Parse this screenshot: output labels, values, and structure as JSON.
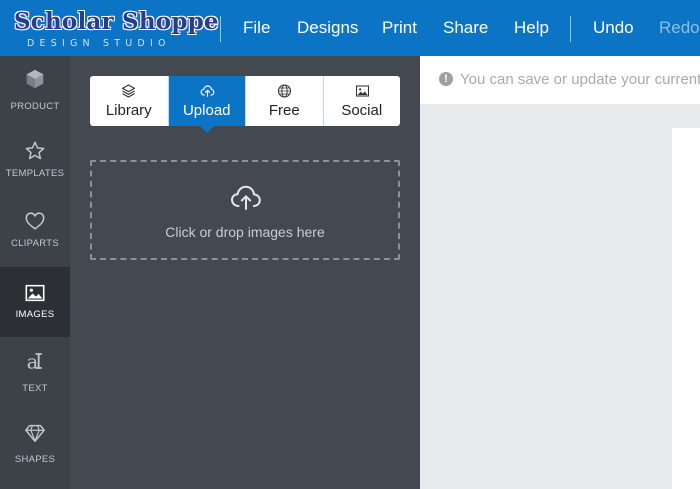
{
  "header": {
    "logo_main": "Scholar Shoppe",
    "logo_sub": "DESIGN STUDIO",
    "menu": [
      "File",
      "Designs",
      "Print",
      "Share",
      "Help"
    ],
    "undo_label": "Undo",
    "redo_label": "Redo"
  },
  "sidebar": {
    "items": [
      {
        "label": "PRODUCT",
        "icon": "cube-icon"
      },
      {
        "label": "TEMPLATES",
        "icon": "star-icon"
      },
      {
        "label": "CLIPARTS",
        "icon": "heart-icon"
      },
      {
        "label": "IMAGES",
        "icon": "image-icon"
      },
      {
        "label": "TEXT",
        "icon": "text-icon"
      },
      {
        "label": "SHAPES",
        "icon": "diamond-icon"
      }
    ],
    "active": "IMAGES"
  },
  "image_tabs": {
    "items": [
      {
        "label": "Library",
        "icon": "layers-icon"
      },
      {
        "label": "Upload",
        "icon": "cloud-upload-icon"
      },
      {
        "label": "Free",
        "icon": "globe-icon"
      },
      {
        "label": "Social",
        "icon": "picture-icon"
      }
    ],
    "active": "Upload"
  },
  "dropzone": {
    "text": "Click or drop images here",
    "icon": "cloud-upload-icon"
  },
  "notice": {
    "text": "You can save or update your current",
    "icon_glyph": "!"
  },
  "colors": {
    "brand_blue": "#0c74c4",
    "panel_bg": "#434851",
    "rail_bg": "#2c2f35",
    "workspace_bg": "#e9eaeb"
  }
}
